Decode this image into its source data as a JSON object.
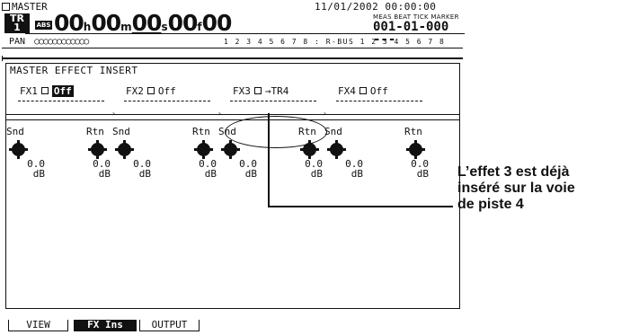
{
  "status": {
    "master_label": "MASTER",
    "date": "11/01/2002",
    "time": "00:00:00",
    "track_label": "TR",
    "track_number": "1",
    "abs_label": "ABS",
    "timecode": {
      "hh": "00",
      "mm": "00",
      "ss": "00",
      "ff": "00",
      "h_unit": "h",
      "m_unit": "m",
      "s_unit": "s",
      "f_unit": "f"
    },
    "meas_beat_tick_label": "MEAS BEAT TICK MARKER",
    "meas_beat_tick_value": "001-01-000",
    "marker_value": "---",
    "pan_label": "PAN",
    "pan_track_nums": "1 2 3 4 5 6 7 8 : R-BUS 1 2 3 4 5 6 7 8"
  },
  "panel": {
    "title": "MASTER EFFECT INSERT",
    "fx": [
      {
        "name": "FX1",
        "value": "Off",
        "inverted": true
      },
      {
        "name": "FX2",
        "value": "Off",
        "inverted": false
      },
      {
        "name": "FX3",
        "value": "→TR4",
        "inverted": false
      },
      {
        "name": "FX4",
        "value": "Off",
        "inverted": false
      }
    ],
    "channels": [
      {
        "snd_label": "Snd",
        "rtn_label": "Rtn",
        "snd_value": "0.0",
        "rtn_value": "0.0",
        "unit": "dB"
      },
      {
        "snd_label": "Snd",
        "rtn_label": "Rtn",
        "snd_value": "0.0",
        "rtn_value": "0.0",
        "unit": "dB"
      },
      {
        "snd_label": "Snd",
        "rtn_label": "Rtn",
        "snd_value": "0.0",
        "rtn_value": "0.0",
        "unit": "dB"
      },
      {
        "snd_label": "Snd",
        "rtn_label": "Rtn",
        "snd_value": "0.0",
        "rtn_value": "0.0",
        "unit": "dB"
      }
    ]
  },
  "tabs": [
    {
      "label": "VIEW",
      "active": false
    },
    {
      "label": "FX Ins",
      "active": true
    },
    {
      "label": "OUTPUT",
      "active": false
    }
  ],
  "callout": {
    "line1": "L’effet 3 est déjà",
    "line2": "inséré sur la voie",
    "line3": "de piste 4"
  }
}
